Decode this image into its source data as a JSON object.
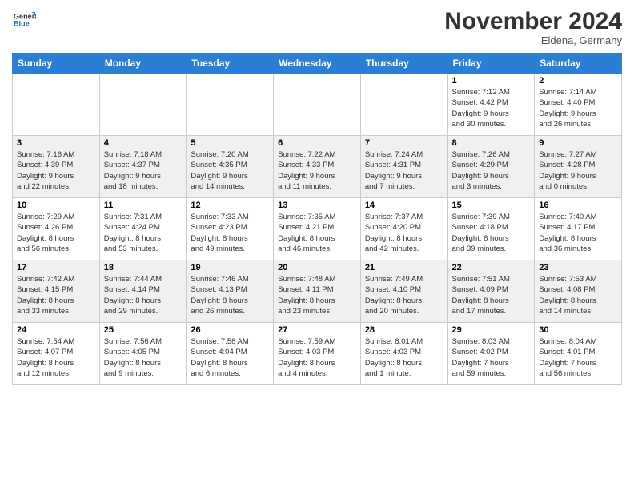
{
  "header": {
    "logo_line1": "General",
    "logo_line2": "Blue",
    "month_title": "November 2024",
    "location": "Eldena, Germany"
  },
  "days_of_week": [
    "Sunday",
    "Monday",
    "Tuesday",
    "Wednesday",
    "Thursday",
    "Friday",
    "Saturday"
  ],
  "weeks": [
    [
      {
        "day": "",
        "info": ""
      },
      {
        "day": "",
        "info": ""
      },
      {
        "day": "",
        "info": ""
      },
      {
        "day": "",
        "info": ""
      },
      {
        "day": "",
        "info": ""
      },
      {
        "day": "1",
        "info": "Sunrise: 7:12 AM\nSunset: 4:42 PM\nDaylight: 9 hours\nand 30 minutes."
      },
      {
        "day": "2",
        "info": "Sunrise: 7:14 AM\nSunset: 4:40 PM\nDaylight: 9 hours\nand 26 minutes."
      }
    ],
    [
      {
        "day": "3",
        "info": "Sunrise: 7:16 AM\nSunset: 4:39 PM\nDaylight: 9 hours\nand 22 minutes."
      },
      {
        "day": "4",
        "info": "Sunrise: 7:18 AM\nSunset: 4:37 PM\nDaylight: 9 hours\nand 18 minutes."
      },
      {
        "day": "5",
        "info": "Sunrise: 7:20 AM\nSunset: 4:35 PM\nDaylight: 9 hours\nand 14 minutes."
      },
      {
        "day": "6",
        "info": "Sunrise: 7:22 AM\nSunset: 4:33 PM\nDaylight: 9 hours\nand 11 minutes."
      },
      {
        "day": "7",
        "info": "Sunrise: 7:24 AM\nSunset: 4:31 PM\nDaylight: 9 hours\nand 7 minutes."
      },
      {
        "day": "8",
        "info": "Sunrise: 7:26 AM\nSunset: 4:29 PM\nDaylight: 9 hours\nand 3 minutes."
      },
      {
        "day": "9",
        "info": "Sunrise: 7:27 AM\nSunset: 4:28 PM\nDaylight: 9 hours\nand 0 minutes."
      }
    ],
    [
      {
        "day": "10",
        "info": "Sunrise: 7:29 AM\nSunset: 4:26 PM\nDaylight: 8 hours\nand 56 minutes."
      },
      {
        "day": "11",
        "info": "Sunrise: 7:31 AM\nSunset: 4:24 PM\nDaylight: 8 hours\nand 53 minutes."
      },
      {
        "day": "12",
        "info": "Sunrise: 7:33 AM\nSunset: 4:23 PM\nDaylight: 8 hours\nand 49 minutes."
      },
      {
        "day": "13",
        "info": "Sunrise: 7:35 AM\nSunset: 4:21 PM\nDaylight: 8 hours\nand 46 minutes."
      },
      {
        "day": "14",
        "info": "Sunrise: 7:37 AM\nSunset: 4:20 PM\nDaylight: 8 hours\nand 42 minutes."
      },
      {
        "day": "15",
        "info": "Sunrise: 7:39 AM\nSunset: 4:18 PM\nDaylight: 8 hours\nand 39 minutes."
      },
      {
        "day": "16",
        "info": "Sunrise: 7:40 AM\nSunset: 4:17 PM\nDaylight: 8 hours\nand 36 minutes."
      }
    ],
    [
      {
        "day": "17",
        "info": "Sunrise: 7:42 AM\nSunset: 4:15 PM\nDaylight: 8 hours\nand 33 minutes."
      },
      {
        "day": "18",
        "info": "Sunrise: 7:44 AM\nSunset: 4:14 PM\nDaylight: 8 hours\nand 29 minutes."
      },
      {
        "day": "19",
        "info": "Sunrise: 7:46 AM\nSunset: 4:13 PM\nDaylight: 8 hours\nand 26 minutes."
      },
      {
        "day": "20",
        "info": "Sunrise: 7:48 AM\nSunset: 4:11 PM\nDaylight: 8 hours\nand 23 minutes."
      },
      {
        "day": "21",
        "info": "Sunrise: 7:49 AM\nSunset: 4:10 PM\nDaylight: 8 hours\nand 20 minutes."
      },
      {
        "day": "22",
        "info": "Sunrise: 7:51 AM\nSunset: 4:09 PM\nDaylight: 8 hours\nand 17 minutes."
      },
      {
        "day": "23",
        "info": "Sunrise: 7:53 AM\nSunset: 4:08 PM\nDaylight: 8 hours\nand 14 minutes."
      }
    ],
    [
      {
        "day": "24",
        "info": "Sunrise: 7:54 AM\nSunset: 4:07 PM\nDaylight: 8 hours\nand 12 minutes."
      },
      {
        "day": "25",
        "info": "Sunrise: 7:56 AM\nSunset: 4:05 PM\nDaylight: 8 hours\nand 9 minutes."
      },
      {
        "day": "26",
        "info": "Sunrise: 7:58 AM\nSunset: 4:04 PM\nDaylight: 8 hours\nand 6 minutes."
      },
      {
        "day": "27",
        "info": "Sunrise: 7:59 AM\nSunset: 4:03 PM\nDaylight: 8 hours\nand 4 minutes."
      },
      {
        "day": "28",
        "info": "Sunrise: 8:01 AM\nSunset: 4:03 PM\nDaylight: 8 hours\nand 1 minute."
      },
      {
        "day": "29",
        "info": "Sunrise: 8:03 AM\nSunset: 4:02 PM\nDaylight: 7 hours\nand 59 minutes."
      },
      {
        "day": "30",
        "info": "Sunrise: 8:04 AM\nSunset: 4:01 PM\nDaylight: 7 hours\nand 56 minutes."
      }
    ]
  ]
}
